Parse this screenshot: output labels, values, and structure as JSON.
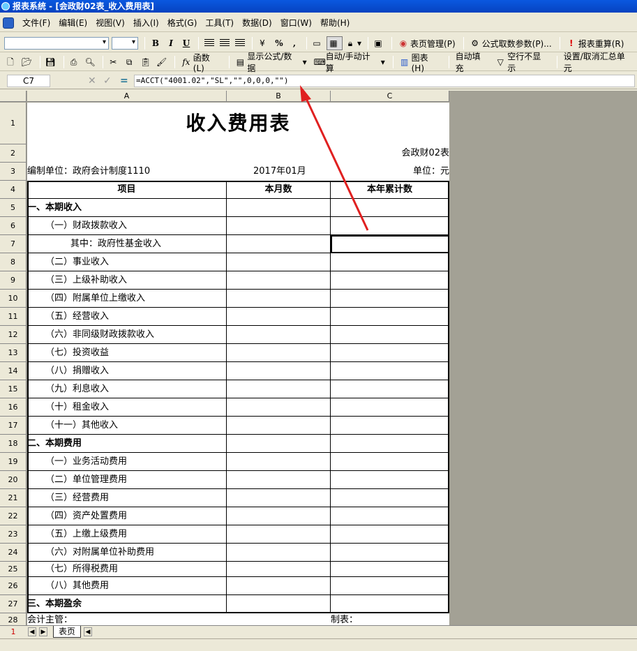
{
  "window": {
    "title": "报表系统 - [会政财02表_收入费用表]"
  },
  "menu": [
    "文件(F)",
    "编辑(E)",
    "视图(V)",
    "插入(I)",
    "格式(G)",
    "工具(T)",
    "数据(D)",
    "窗口(W)",
    "帮助(H)"
  ],
  "toolbar1": {
    "bold": "B",
    "italic": "I",
    "underline": "U",
    "percent": "%",
    "comma": ",",
    "page_mgmt": "表页管理(P)",
    "formula_params": "公式取数参数(P)...",
    "recalc": "报表重算(R)"
  },
  "toolbar2": {
    "func": "函数(L)",
    "show_formula": "显示公式/数据",
    "auto_calc": "自动/手动计算",
    "chart": "图表(H)",
    "autofill": "自动填充",
    "blank_row": "空行不显示",
    "set_total": "设置/取消汇总单元"
  },
  "formula_bar": {
    "cell_ref": "C7",
    "formula": "=ACCT(\"4001.02\",\"SL\",\"\",0,0,0,\"\")"
  },
  "columns": [
    "A",
    "B",
    "C"
  ],
  "report": {
    "title": "收入费用表",
    "code": "会政财02表",
    "unit": "编制单位：政府会计制度1110",
    "period": "2017年01月",
    "currency": "单位：元",
    "headers": [
      "项目",
      "本月数",
      "本年累计数"
    ],
    "items": [
      "一、本期收入",
      "（一）财政拨款收入",
      "其中：政府性基金收入",
      "（二）事业收入",
      "（三）上级补助收入",
      "（四）附属单位上缴收入",
      "（五）经营收入",
      "（六）非同级财政拨款收入",
      "（七）投资收益",
      "（八）捐赠收入",
      "（九）利息收入",
      "（十）租金收入",
      "（十一）其他收入",
      "二、本期费用",
      "（一）业务活动费用",
      "（二）单位管理费用",
      "（三）经营费用",
      "（四）资产处置费用",
      "（五）上缴上级费用",
      "（六）对附属单位补助费用",
      "（七）所得税费用",
      "（八）其他费用",
      "三、本期盈余"
    ],
    "footer_left": "会计主管：",
    "footer_right": "制表："
  },
  "row_numbers": [
    "1",
    "2",
    "3",
    "4",
    "5",
    "6",
    "7",
    "8",
    "9",
    "10",
    "11",
    "12",
    "13",
    "14",
    "15",
    "16",
    "17",
    "18",
    "19",
    "20",
    "21",
    "22",
    "23",
    "24",
    "25",
    "26",
    "27",
    "28"
  ],
  "tabs": {
    "active_row": "1",
    "sheet_tab": "表页"
  },
  "colors": {
    "arrow": "#e02020",
    "titlebar": "#0a58e0"
  }
}
